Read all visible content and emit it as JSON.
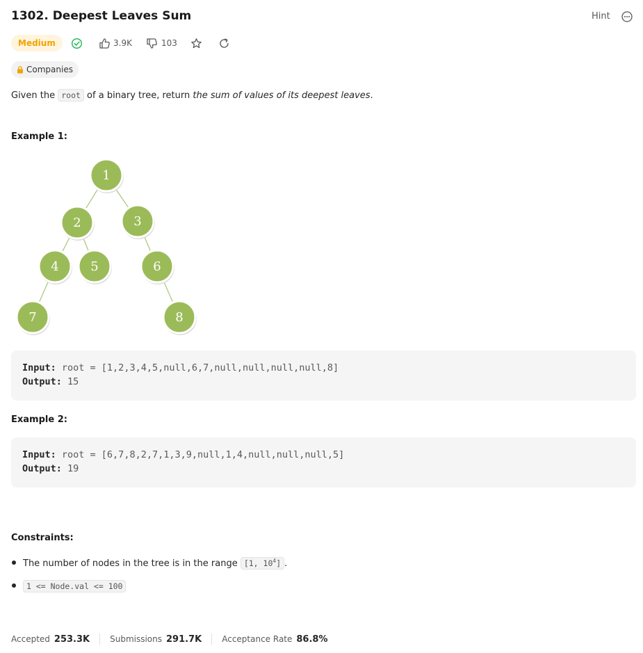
{
  "problem": {
    "title": "1302. Deepest Leaves Sum",
    "hint_label": "Hint",
    "difficulty": "Medium",
    "likes": "3.9K",
    "dislikes": "103",
    "companies_label": "Companies"
  },
  "description": {
    "part1": "Given the ",
    "code": "root",
    "part2": " of a binary tree, return ",
    "emphasis": "the sum of values of its deepest leaves",
    "part3": "."
  },
  "example1": {
    "heading": "Example 1:",
    "tree_nodes": [
      "1",
      "2",
      "3",
      "4",
      "5",
      "6",
      "7",
      "8"
    ],
    "input_label": "Input:",
    "input_value": " root = [1,2,3,4,5,null,6,7,null,null,null,null,8]",
    "output_label": "Output:",
    "output_value": " 15"
  },
  "example2": {
    "heading": "Example 2:",
    "input_label": "Input:",
    "input_value": " root = [6,7,8,2,7,1,3,9,null,1,4,null,null,null,5]",
    "output_label": "Output:",
    "output_value": " 19"
  },
  "constraints": {
    "heading": "Constraints:",
    "item1_text": "The number of nodes in the tree is in the range ",
    "item1_code": "[1, 10",
    "item1_sup": "4",
    "item1_code_end": "]",
    "item1_end": ".",
    "item2_code": "1 <= Node.val <= 100"
  },
  "stats": {
    "accepted_label": "Accepted",
    "accepted_value": "253.3K",
    "submissions_label": "Submissions",
    "submissions_value": "291.7K",
    "rate_label": "Acceptance Rate",
    "rate_value": "86.8%"
  },
  "colors": {
    "node_fill": "#9bbb59",
    "solved": "#2cbb5d",
    "medium": "#f1a400"
  },
  "icons": [
    "solved-check-icon",
    "thumbs-up-icon",
    "thumbs-down-icon",
    "star-icon",
    "share-icon",
    "more-icon",
    "lock-icon"
  ]
}
